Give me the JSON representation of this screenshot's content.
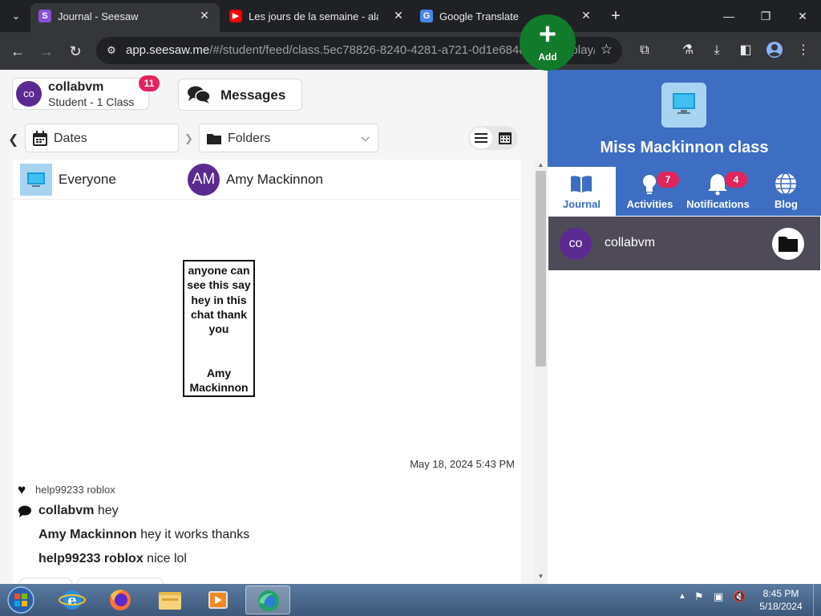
{
  "browser": {
    "tabs": [
      {
        "title": "Journal - Seesaw",
        "favicon": "seesaw-icon",
        "active": true
      },
      {
        "title": "Les jours de la semaine - alain",
        "favicon": "youtube-icon",
        "active": false
      },
      {
        "title": "Google Translate",
        "favicon": "google-translate-icon",
        "active": false
      }
    ],
    "url_host": "app.seesaw.me",
    "url_path": "/#/student/feed/class.5ec78826-8240-4281-a721-0d1e6848095e/display/jour..."
  },
  "header": {
    "user": {
      "initials": "co",
      "name": "collabvm",
      "subtitle": "Student - 1 Class",
      "badge": "11"
    },
    "messages_label": "Messages",
    "add_label": "Add"
  },
  "filters": {
    "dates_label": "Dates",
    "folders_label": "Folders"
  },
  "feed": {
    "audience": "Everyone",
    "author_initials": "AM",
    "author_name": "Amy Mackinnon",
    "note_text": "anyone can see this say hey in this chat thank you",
    "note_signature": "Amy Mackinnon",
    "timestamp": "May 18, 2024 5:43 PM",
    "likes_by": "help99233 roblox",
    "comments": [
      {
        "author": "collabvm",
        "text": "hey"
      },
      {
        "author": "Amy Mackinnon",
        "text": "hey it works thanks"
      },
      {
        "author": "help99233 roblox",
        "text": "nice lol"
      }
    ]
  },
  "class_panel": {
    "class_name": "Miss Mackinnon class",
    "tabs": [
      {
        "label": "Journal",
        "badge": null
      },
      {
        "label": "Activities",
        "badge": "7"
      },
      {
        "label": "Notifications",
        "badge": "4"
      },
      {
        "label": "Blog",
        "badge": null
      }
    ],
    "students": [
      {
        "initials": "co",
        "name": "collabvm"
      }
    ]
  },
  "taskbar": {
    "time": "8:45 PM",
    "date": "5/18/2024"
  },
  "colors": {
    "seesaw_blue": "#3d6ec2",
    "add_green": "#127a2b",
    "badge_pink": "#e0245e",
    "avatar_purple": "#5b2a91"
  }
}
